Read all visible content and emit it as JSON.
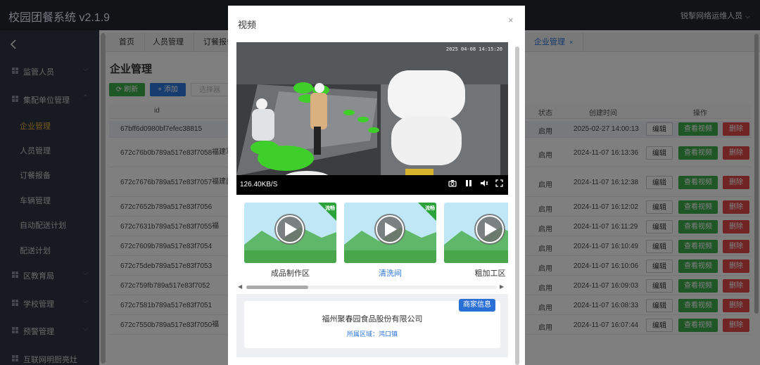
{
  "app": {
    "title": "校园团餐系统 v2.1.9",
    "user": "锐掣网络运维人员"
  },
  "sidebar": {
    "items": [
      {
        "label": "监管人员"
      },
      {
        "label": "集配单位管理"
      },
      {
        "label": "区教育局"
      },
      {
        "label": "学校管理"
      },
      {
        "label": "预警管理"
      },
      {
        "label": "互联网明厨亮灶"
      }
    ],
    "subitems": [
      {
        "label": "企业管理"
      },
      {
        "label": "人员管理"
      },
      {
        "label": "订餐报备"
      },
      {
        "label": "车辆管理"
      },
      {
        "label": "自动配送计划"
      },
      {
        "label": "配送计划"
      }
    ]
  },
  "tabs": [
    {
      "label": "首页"
    },
    {
      "label": "人员管理"
    },
    {
      "label": "订餐报备"
    },
    {
      "label": "企业管理"
    }
  ],
  "page": {
    "title": "企业管理",
    "refresh_label": "刷新",
    "add_label": "添加",
    "select_label": "选择器"
  },
  "table": {
    "headers": {
      "id": "id",
      "status": "状态",
      "created": "创建时间",
      "actions": "操作"
    },
    "buttons": {
      "edit": "编辑",
      "view": "查看视频",
      "delete": "删除"
    },
    "rows": [
      {
        "id": "67bff6d0980bf7efec38815",
        "name": "",
        "status": "启用",
        "created": "2025-02-27 14:00:13"
      },
      {
        "id": "672c76b0b789a517e83f7058",
        "name": "福建军",
        "status": "启用",
        "created": "2024-11-07 16:13:36"
      },
      {
        "id": "672c7676b789a517e83f7057",
        "name": "福建菌",
        "status": "启用",
        "created": "2024-11-07 16:12:38"
      },
      {
        "id": "672c7652b789a517e83f7056",
        "name": "",
        "status": "启用",
        "created": "2024-11-07 16:12:02"
      },
      {
        "id": "672c7631b789a517e83f7055",
        "name": "福",
        "status": "启用",
        "created": "2024-11-07 16:11:29"
      },
      {
        "id": "672c7609b789a517e83f7054",
        "name": "",
        "status": "启用",
        "created": "2024-11-07 16:10:49"
      },
      {
        "id": "672c75deb789a517e83f7053",
        "name": "",
        "status": "启用",
        "created": "2024-11-07 16:10:06"
      },
      {
        "id": "672c759fb789a517e83f7052",
        "name": "",
        "status": "启用",
        "created": "2024-11-07 16:09:03"
      },
      {
        "id": "672c7581b789a517e83f7051",
        "name": "",
        "status": "启用",
        "created": "2024-11-07 16:08:33"
      },
      {
        "id": "672c7550b789a517e83f7050",
        "name": "福",
        "status": "启用",
        "created": "2024-11-07 16:07:44"
      }
    ]
  },
  "modal": {
    "title": "视频",
    "close": "×",
    "video": {
      "timestamp": "2025 04-08 14:15:20",
      "rate": "126.40KB/S"
    },
    "thumbnails": [
      {
        "label": "成品制作区",
        "badge": "流畅"
      },
      {
        "label": "清洗间",
        "badge": "流畅"
      },
      {
        "label": "粗加工区",
        "badge": ""
      }
    ],
    "merchant": {
      "badge": "商家信息",
      "name": "福州聚春园食品股份有限公司",
      "area": "所属区域：鸿口镇"
    }
  },
  "colors": {
    "green": "#3cae4a",
    "blue": "#2f7ae0",
    "red": "#e04848",
    "sidebar": "#2f3440",
    "active_gold": "#e6b53c"
  }
}
